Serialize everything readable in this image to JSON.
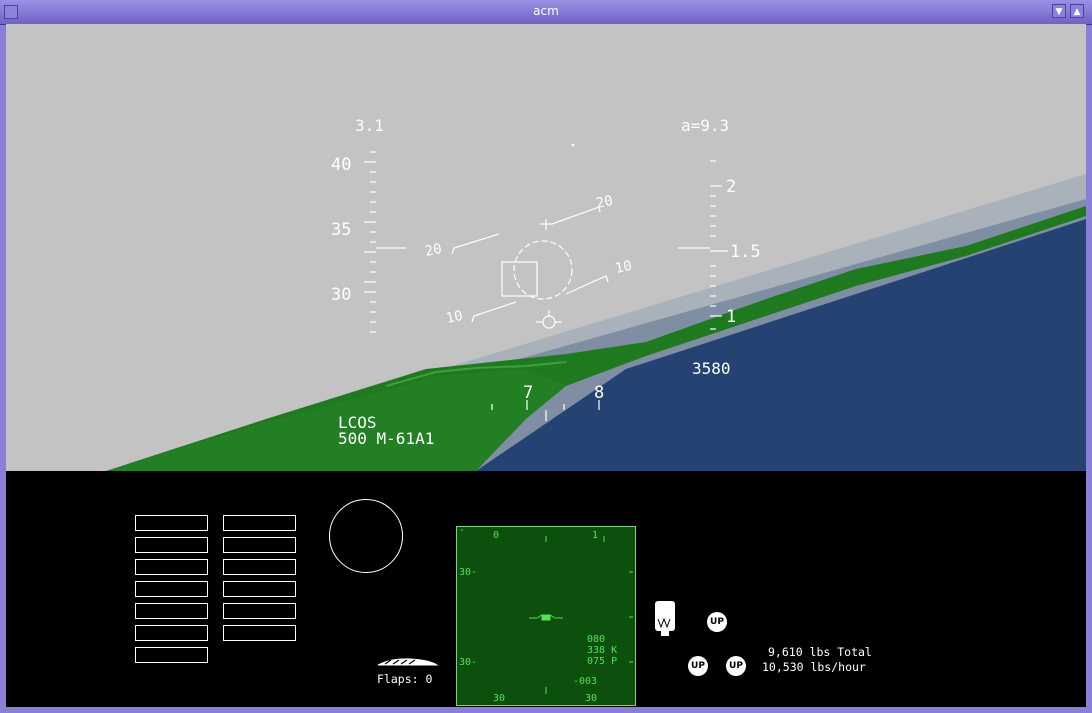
{
  "window": {
    "title": "acm"
  },
  "hud": {
    "g_load": "3.1",
    "alpha": "a=9.3",
    "speed_ticks": [
      "40",
      "35",
      "30"
    ],
    "alt_ticks": [
      "2",
      "1.5",
      "1"
    ],
    "altitude": "3580",
    "pitch_labels": [
      "20",
      "20",
      "10",
      "10"
    ],
    "heading_ticks": [
      "7",
      "8"
    ],
    "mode": "LCOS",
    "weapon": "500 M-61A1"
  },
  "panel": {
    "flaps": "Flaps: 0",
    "radar": {
      "top_left": "0",
      "top_right": "1",
      "range_upper": "30-",
      "range_lower": "30-",
      "bottom_left": "30",
      "bottom_right": "30",
      "readout_1": "080",
      "readout_2": "338 K",
      "readout_3": "075 P",
      "readout_4": "-003"
    },
    "gear": [
      "UP",
      "UP",
      "UP"
    ],
    "fuel_total": "9,610 lbs Total",
    "fuel_rate": "10,530 lbs/hour"
  },
  "colors": {
    "sky": "#c3c3c3",
    "terrain": "#1f7a1f",
    "water": "#244372",
    "hud": "#ffffff",
    "radar_bg": "#0d4f0d",
    "radar_text": "#55e055"
  }
}
